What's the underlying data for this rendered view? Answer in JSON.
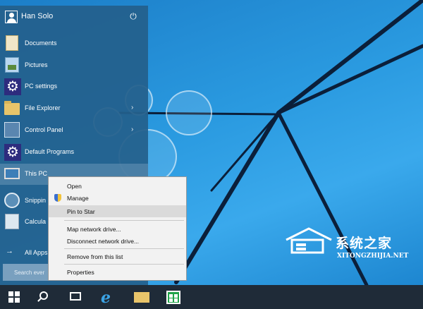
{
  "colors": {
    "desktop": "#1a8fd8",
    "start_menu": "#24608c",
    "taskbar": "#1f2b38",
    "menu_bg": "#f2f2f2",
    "tile_gear": "#2d2c7e"
  },
  "user": {
    "name": "Han Solo",
    "avatar_icon": "user-icon",
    "power_icon": "power-icon"
  },
  "start_items": [
    {
      "label": "Documents",
      "icon": "documents-folder-icon"
    },
    {
      "label": "Pictures",
      "icon": "pictures-folder-icon"
    },
    {
      "label": "PC settings",
      "icon": "gear-icon"
    },
    {
      "label": "File Explorer",
      "icon": "file-explorer-icon",
      "arrow": "›"
    },
    {
      "label": "Control Panel",
      "icon": "control-panel-icon",
      "arrow": "›"
    },
    {
      "label": "Default Programs",
      "icon": "gear-icon"
    },
    {
      "label": "This PC",
      "icon": "this-pc-icon",
      "selected": true
    },
    {
      "label": "Snippin",
      "icon": "snipping-tool-icon"
    },
    {
      "label": "Calcula",
      "icon": "calculator-icon"
    }
  ],
  "all_apps": {
    "label": "All Apps",
    "arrow": "→"
  },
  "search": {
    "placeholder": "Search ever"
  },
  "context_menu": {
    "items": [
      {
        "label": "Open",
        "accel": "O"
      },
      {
        "label": "Manage",
        "accel": "",
        "icon": "shield-icon"
      },
      {
        "label": "Pin to Start",
        "accel": "P",
        "visible_text": "Pin to Star",
        "highlighted": true
      },
      {
        "label": "Map network drive...",
        "accel": "n"
      },
      {
        "label": "Disconnect network drive...",
        "accel": "c"
      },
      {
        "label": "Remove from this list",
        "accel": "f"
      },
      {
        "label": "Properties",
        "accel": "r"
      }
    ]
  },
  "taskbar": {
    "buttons": [
      "start-windows-icon",
      "search-icon",
      "task-view-icon",
      "internet-explorer-icon",
      "file-explorer-icon",
      "store-icon"
    ]
  },
  "watermark": {
    "title": "系统之家",
    "subtitle": "XITONGZHIJIA.NET"
  },
  "power_glyph": "⏻",
  "gear_glyph": "⚙"
}
